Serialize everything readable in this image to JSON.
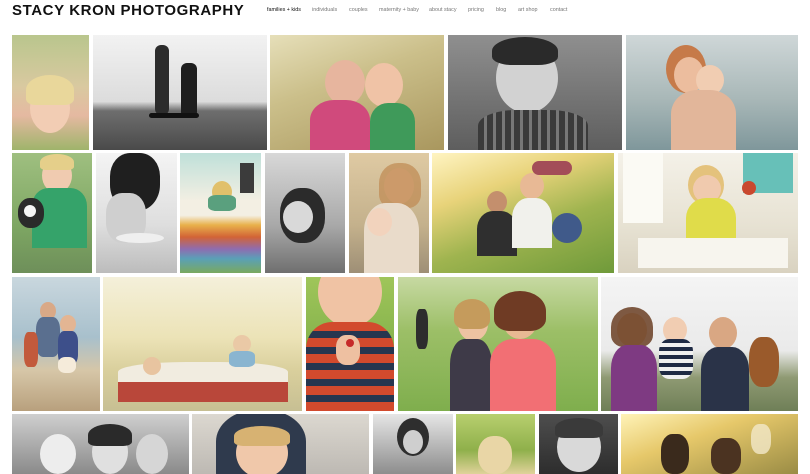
{
  "site": {
    "title": "STACY KRON PHOTOGRAPHY"
  },
  "nav": {
    "items": [
      {
        "label": "families + kids",
        "active": true
      },
      {
        "label": "individuals",
        "active": false
      },
      {
        "label": "couples",
        "active": false
      },
      {
        "label": "maternity + baby",
        "active": false
      },
      {
        "label": "about stacy",
        "active": false
      },
      {
        "label": "pricing",
        "active": false
      },
      {
        "label": "blog",
        "active": false
      },
      {
        "label": "art shop",
        "active": false
      },
      {
        "label": "contact",
        "active": false
      }
    ]
  }
}
